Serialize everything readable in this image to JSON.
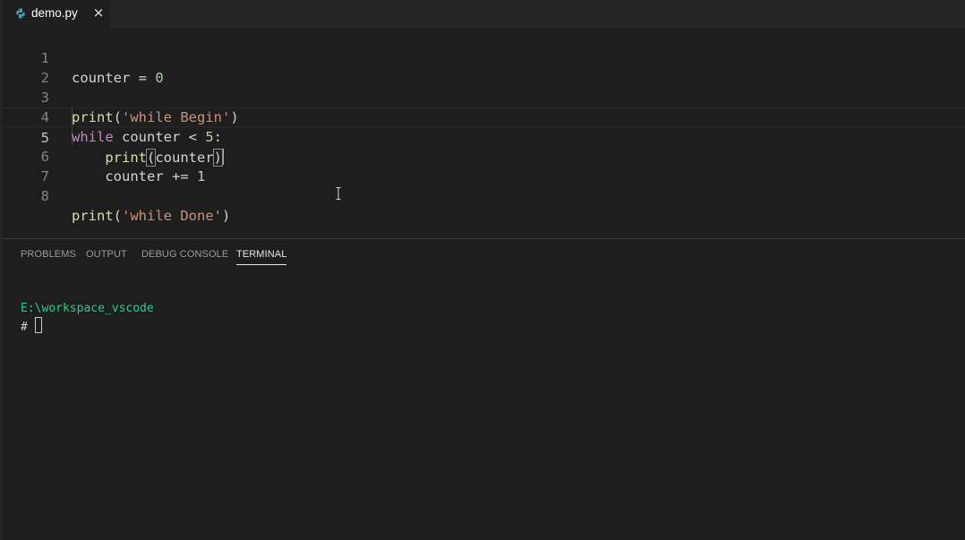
{
  "tab": {
    "filename": "demo.py",
    "close_glyph": "×",
    "icon": "python-icon"
  },
  "editor": {
    "current_line": 5,
    "lines": [
      {
        "n": "1"
      },
      {
        "n": "2"
      },
      {
        "n": "3"
      },
      {
        "n": "4"
      },
      {
        "n": "5"
      },
      {
        "n": "6"
      },
      {
        "n": "7"
      },
      {
        "n": "8"
      }
    ],
    "tokens": {
      "l1_var": "counter",
      "l1_op": " = ",
      "l1_num": "0",
      "l3_fn": "print",
      "l3_open": "(",
      "l3_str": "'while Begin'",
      "l3_close": ")",
      "l4_kw": "while",
      "l4_rest": " counter < ",
      "l4_num": "5",
      "l4_colon": ":",
      "l5_indent": "    ",
      "l5_fn": "print",
      "l5_open": "(",
      "l5_arg": "counter",
      "l5_close": ")",
      "l6_indent": "    ",
      "l6_rest": "counter += ",
      "l6_num": "1",
      "l8_fn": "print",
      "l8_open": "(",
      "l8_str": "'while Done'",
      "l8_close": ")"
    }
  },
  "panel": {
    "tabs": [
      {
        "label": "PROBLEMS"
      },
      {
        "label": "OUTPUT"
      },
      {
        "label": "DEBUG CONSOLE"
      },
      {
        "label": "TERMINAL"
      }
    ],
    "active_tab": "TERMINAL",
    "terminal": {
      "path": "E:\\workspace_vscode",
      "prompt": "#"
    }
  },
  "colors": {
    "background": "#1e1e1e",
    "keyword": "#c586c0",
    "function": "#dcdcaa",
    "string": "#ce9178",
    "number": "#b5cea8",
    "terminal_path": "#23d18b"
  }
}
